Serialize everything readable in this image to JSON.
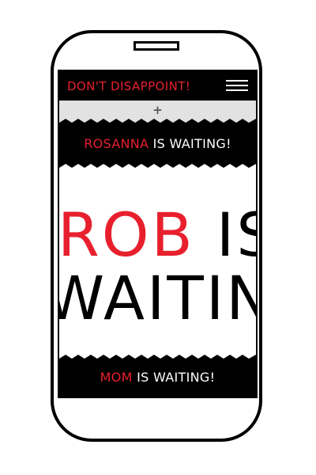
{
  "app": {
    "title": "DON'T DISAPPOINT!",
    "menu_icon": "hamburger-menu-icon",
    "add_label": "+"
  },
  "colors": {
    "accent": "#e8202e",
    "bar": "#000000",
    "strip": "#e2e2e2",
    "text_light": "#ffffff"
  },
  "banners": [
    {
      "name": "ROSANNA",
      "text": " IS WAITING!"
    },
    {
      "name": "MOM",
      "text": " IS WAITING!"
    }
  ],
  "feature": {
    "name": "ROB",
    "text_rest": " IS",
    "line2": "WAITING"
  }
}
